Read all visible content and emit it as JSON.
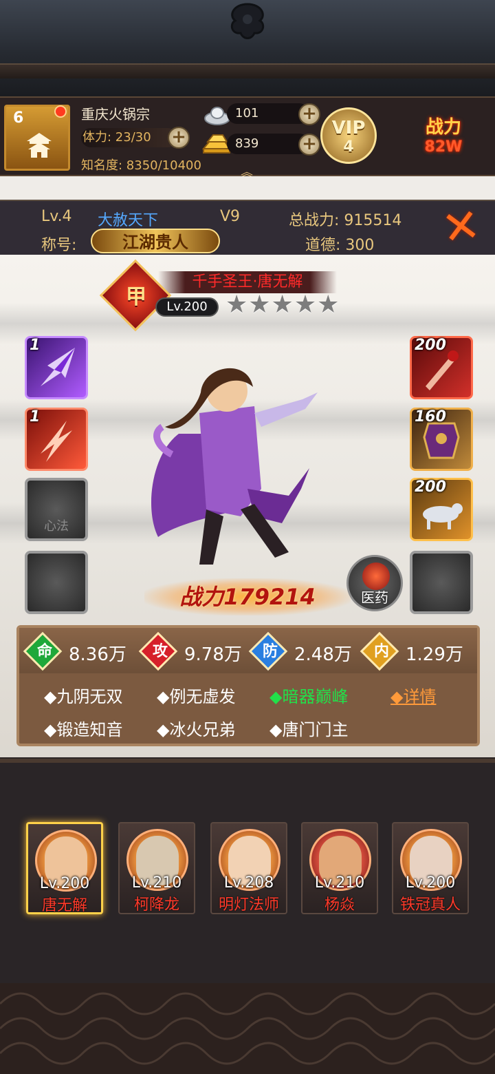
{
  "player": {
    "avatar_level": "6",
    "name": "重庆火锅宗",
    "stamina": "体力: 23/30",
    "fame": "知名度: 8350/10400",
    "silver": "101",
    "gold": "839",
    "vip_label": "VIP",
    "vip_level": "4",
    "power_label": "战力",
    "power_value": "82W"
  },
  "info": {
    "level": "Lv.4",
    "guild": "大赦天下",
    "vip": "V9",
    "total_power": "总战力: 915514",
    "title_label": "称号:",
    "title": "江湖贵人",
    "morality": "道德: 300"
  },
  "hero": {
    "rank_badge": "甲",
    "name": "千手圣王·唐无解",
    "level": "Lv.200",
    "stars": "★★★★★",
    "combat_power": "战力179214",
    "medicine_label": "医药"
  },
  "left_slots": [
    {
      "count": "1",
      "icon": "dart-skill-icon"
    },
    {
      "count": "1",
      "icon": "fire-skill-icon"
    },
    {
      "label": "心法",
      "icon": "empty-slot"
    },
    {
      "label": "",
      "icon": "empty-slot"
    }
  ],
  "right_slots": [
    {
      "count": "200",
      "icon": "weapon-icon"
    },
    {
      "count": "160",
      "icon": "armor-icon"
    },
    {
      "count": "200",
      "icon": "mount-icon"
    },
    {
      "label": "",
      "icon": "empty-slot"
    }
  ],
  "stats": [
    {
      "gem": "命",
      "value": "8.36万",
      "color": "#1ea83a"
    },
    {
      "gem": "攻",
      "value": "9.78万",
      "color": "#d6202a"
    },
    {
      "gem": "防",
      "value": "2.48万",
      "color": "#2a7fe0"
    },
    {
      "gem": "内",
      "value": "1.29万",
      "color": "#e0a020"
    }
  ],
  "skills": [
    "◆九阴无双",
    "◆例无虚发",
    "◆暗器巅峰",
    "◆详情",
    "◆锻造知音",
    "◆冰火兄弟",
    "◆唐门门主"
  ],
  "heroes": [
    {
      "level": "Lv.200",
      "name": "唐无解"
    },
    {
      "level": "Lv.210",
      "name": "柯降龙"
    },
    {
      "level": "Lv.208",
      "name": "明灯法师"
    },
    {
      "level": "Lv.210",
      "name": "杨焱"
    },
    {
      "level": "Lv.200",
      "name": "铁冠真人"
    }
  ]
}
